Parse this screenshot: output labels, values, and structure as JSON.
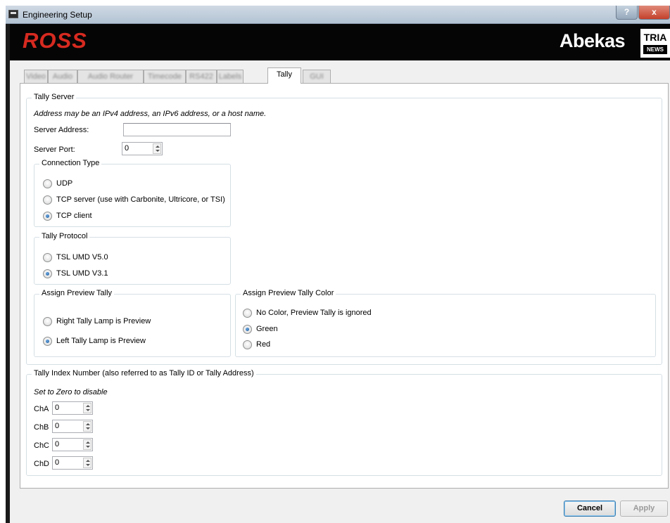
{
  "window": {
    "title": "Engineering Setup",
    "help_label": "?",
    "close_label": "x"
  },
  "header": {
    "left_logo": "ROSS",
    "right_logo": "Abekas",
    "badge_top": "TRIA",
    "badge_bottom": "NEWS"
  },
  "tabs": [
    {
      "label": "Video",
      "active": false
    },
    {
      "label": "Audio",
      "active": false
    },
    {
      "label": "Audio Router",
      "active": false
    },
    {
      "label": "Timecode",
      "active": false
    },
    {
      "label": "RS422",
      "active": false
    },
    {
      "label": "Labels",
      "active": false
    },
    {
      "label": "Tally",
      "active": true
    },
    {
      "label": "GUI",
      "active": false
    }
  ],
  "tally_server": {
    "title": "Tally Server",
    "hint": "Address may be an IPv4 address, an IPv6 address, or a host name.",
    "address_label": "Server Address:",
    "address_value": "",
    "port_label": "Server Port:",
    "port_value": "0",
    "connection_type": {
      "title": "Connection Type",
      "options": [
        {
          "label": "UDP",
          "selected": false
        },
        {
          "label": "TCP server (use with Carbonite, Ultricore, or TSI)",
          "selected": false
        },
        {
          "label": "TCP client",
          "selected": true
        }
      ]
    },
    "tally_protocol": {
      "title": "Tally Protocol",
      "options": [
        {
          "label": "TSL UMD V5.0",
          "selected": false
        },
        {
          "label": "TSL UMD V3.1",
          "selected": true
        }
      ]
    },
    "assign_preview_tally": {
      "title": "Assign Preview Tally",
      "options": [
        {
          "label": "Right Tally Lamp is Preview",
          "selected": false
        },
        {
          "label": "Left Tally Lamp is Preview",
          "selected": true
        }
      ]
    },
    "assign_preview_tally_color": {
      "title": "Assign Preview Tally Color",
      "options": [
        {
          "label": "No Color, Preview Tally is ignored",
          "selected": false
        },
        {
          "label": "Green",
          "selected": true
        },
        {
          "label": "Red",
          "selected": false
        }
      ]
    }
  },
  "tally_index": {
    "title": "Tally Index Number (also referred to as Tally ID or Tally Address)",
    "hint": "Set to Zero to disable",
    "channels": [
      {
        "label": "ChA",
        "value": "0"
      },
      {
        "label": "ChB",
        "value": "0"
      },
      {
        "label": "ChC",
        "value": "0"
      },
      {
        "label": "ChD",
        "value": "0"
      }
    ]
  },
  "buttons": {
    "cancel": "Cancel",
    "apply": "Apply"
  },
  "colors": {
    "ross_red": "#d62a20",
    "header_bg": "#050505",
    "radio_selected": "#1c5a9c"
  }
}
